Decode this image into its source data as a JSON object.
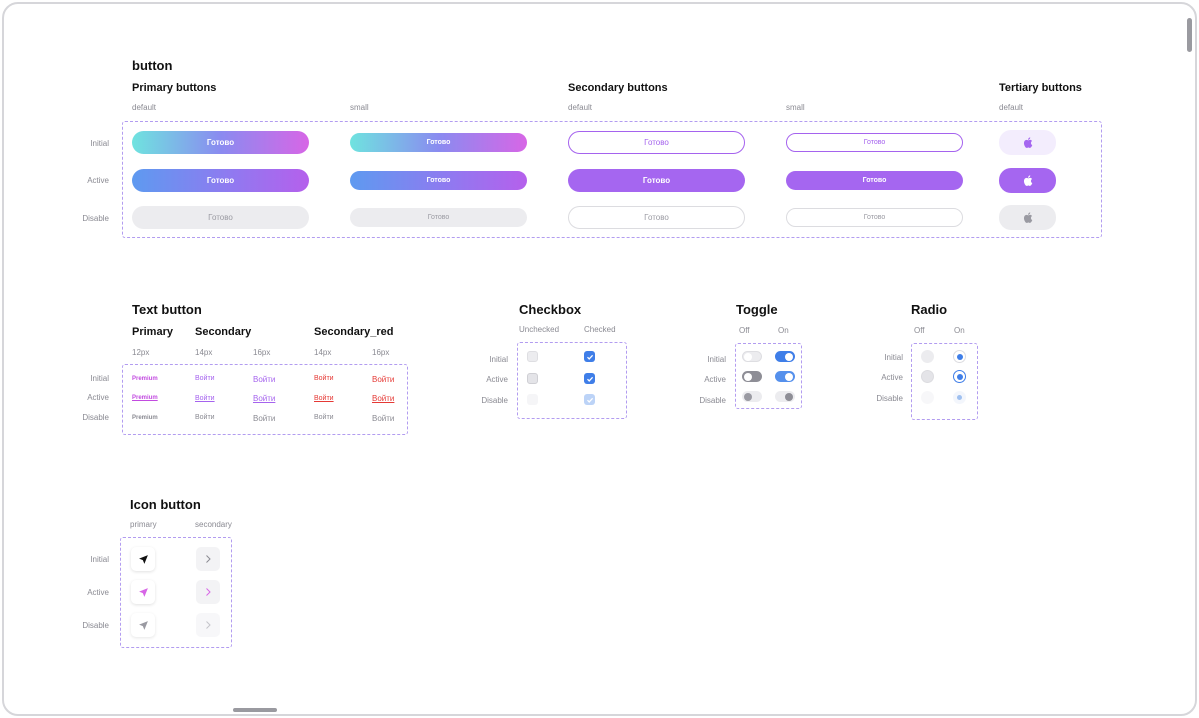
{
  "title": "button",
  "buttons": {
    "primary_heading": "Primary buttons",
    "secondary_heading": "Secondary buttons",
    "tertiary_heading": "Tertiary buttons",
    "col_default": "default",
    "col_small": "small",
    "col_default2": "default",
    "col_small2": "small",
    "col_default3": "default",
    "row_initial": "Initial",
    "row_active": "Active",
    "row_disable": "Disable",
    "label": "Готово",
    "tertiary_icon": "apple-icon",
    "colors": {
      "accent": "#a566f0",
      "gradient_start": "#6fe3df",
      "gradient_end": "#d766e6"
    }
  },
  "text_button": {
    "heading": "Text button",
    "primary": "Primary",
    "secondary": "Secondary",
    "secondary_red": "Secondary_red",
    "size_12": "12px",
    "size_14a": "14px",
    "size_16a": "16px",
    "size_14b": "14px",
    "size_16b": "16px",
    "row_initial": "Initial",
    "row_active": "Active",
    "row_disable": "Disable",
    "premium": "Premium",
    "login": "Войти"
  },
  "checkbox": {
    "heading": "Checkbox",
    "unchecked": "Unchecked",
    "checked": "Checked",
    "row_initial": "Initial",
    "row_active": "Active",
    "row_disable": "Disable"
  },
  "toggle": {
    "heading": "Toggle",
    "off": "Off",
    "on": "On",
    "row_initial": "Initial",
    "row_active": "Active",
    "row_disable": "Disable"
  },
  "radio": {
    "heading": "Radio",
    "off": "Off",
    "on": "On",
    "row_initial": "Initial",
    "row_active": "Active",
    "row_disable": "Disable"
  },
  "icon_button": {
    "heading": "Icon button",
    "primary": "primary",
    "secondary": "secondary",
    "row_initial": "Initial",
    "row_active": "Active",
    "row_disable": "Disable",
    "primary_icon": "send-arrow-icon",
    "secondary_icon": "chevron-right-icon"
  }
}
